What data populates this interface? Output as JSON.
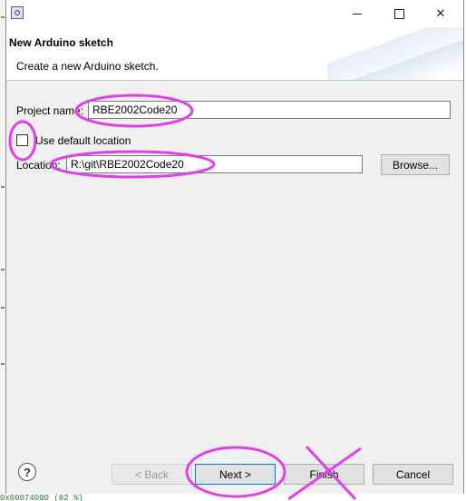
{
  "window": {
    "title": "",
    "icon": "eclipse-app-icon",
    "controls": [
      "minimize",
      "maximize",
      "close"
    ]
  },
  "header": {
    "title": "New Arduino sketch",
    "subtitle": "Create a new Arduino sketch."
  },
  "form": {
    "project_name_label": "Project name:",
    "project_name_value": "RBE2002Code20",
    "use_default_location_label": "Use default location",
    "use_default_location_checked": false,
    "location_label": "Location:",
    "location_value": "R:\\git\\RBE2002Code20",
    "browse_label": "Browse..."
  },
  "buttons": {
    "back_label": "< Back",
    "next_label": "Next >",
    "finish_label": "Finish",
    "cancel_label": "Cancel"
  },
  "background": {
    "bottom_text": "0x00074000    (82 %)"
  },
  "annotations": {
    "color": "#e040e8"
  }
}
